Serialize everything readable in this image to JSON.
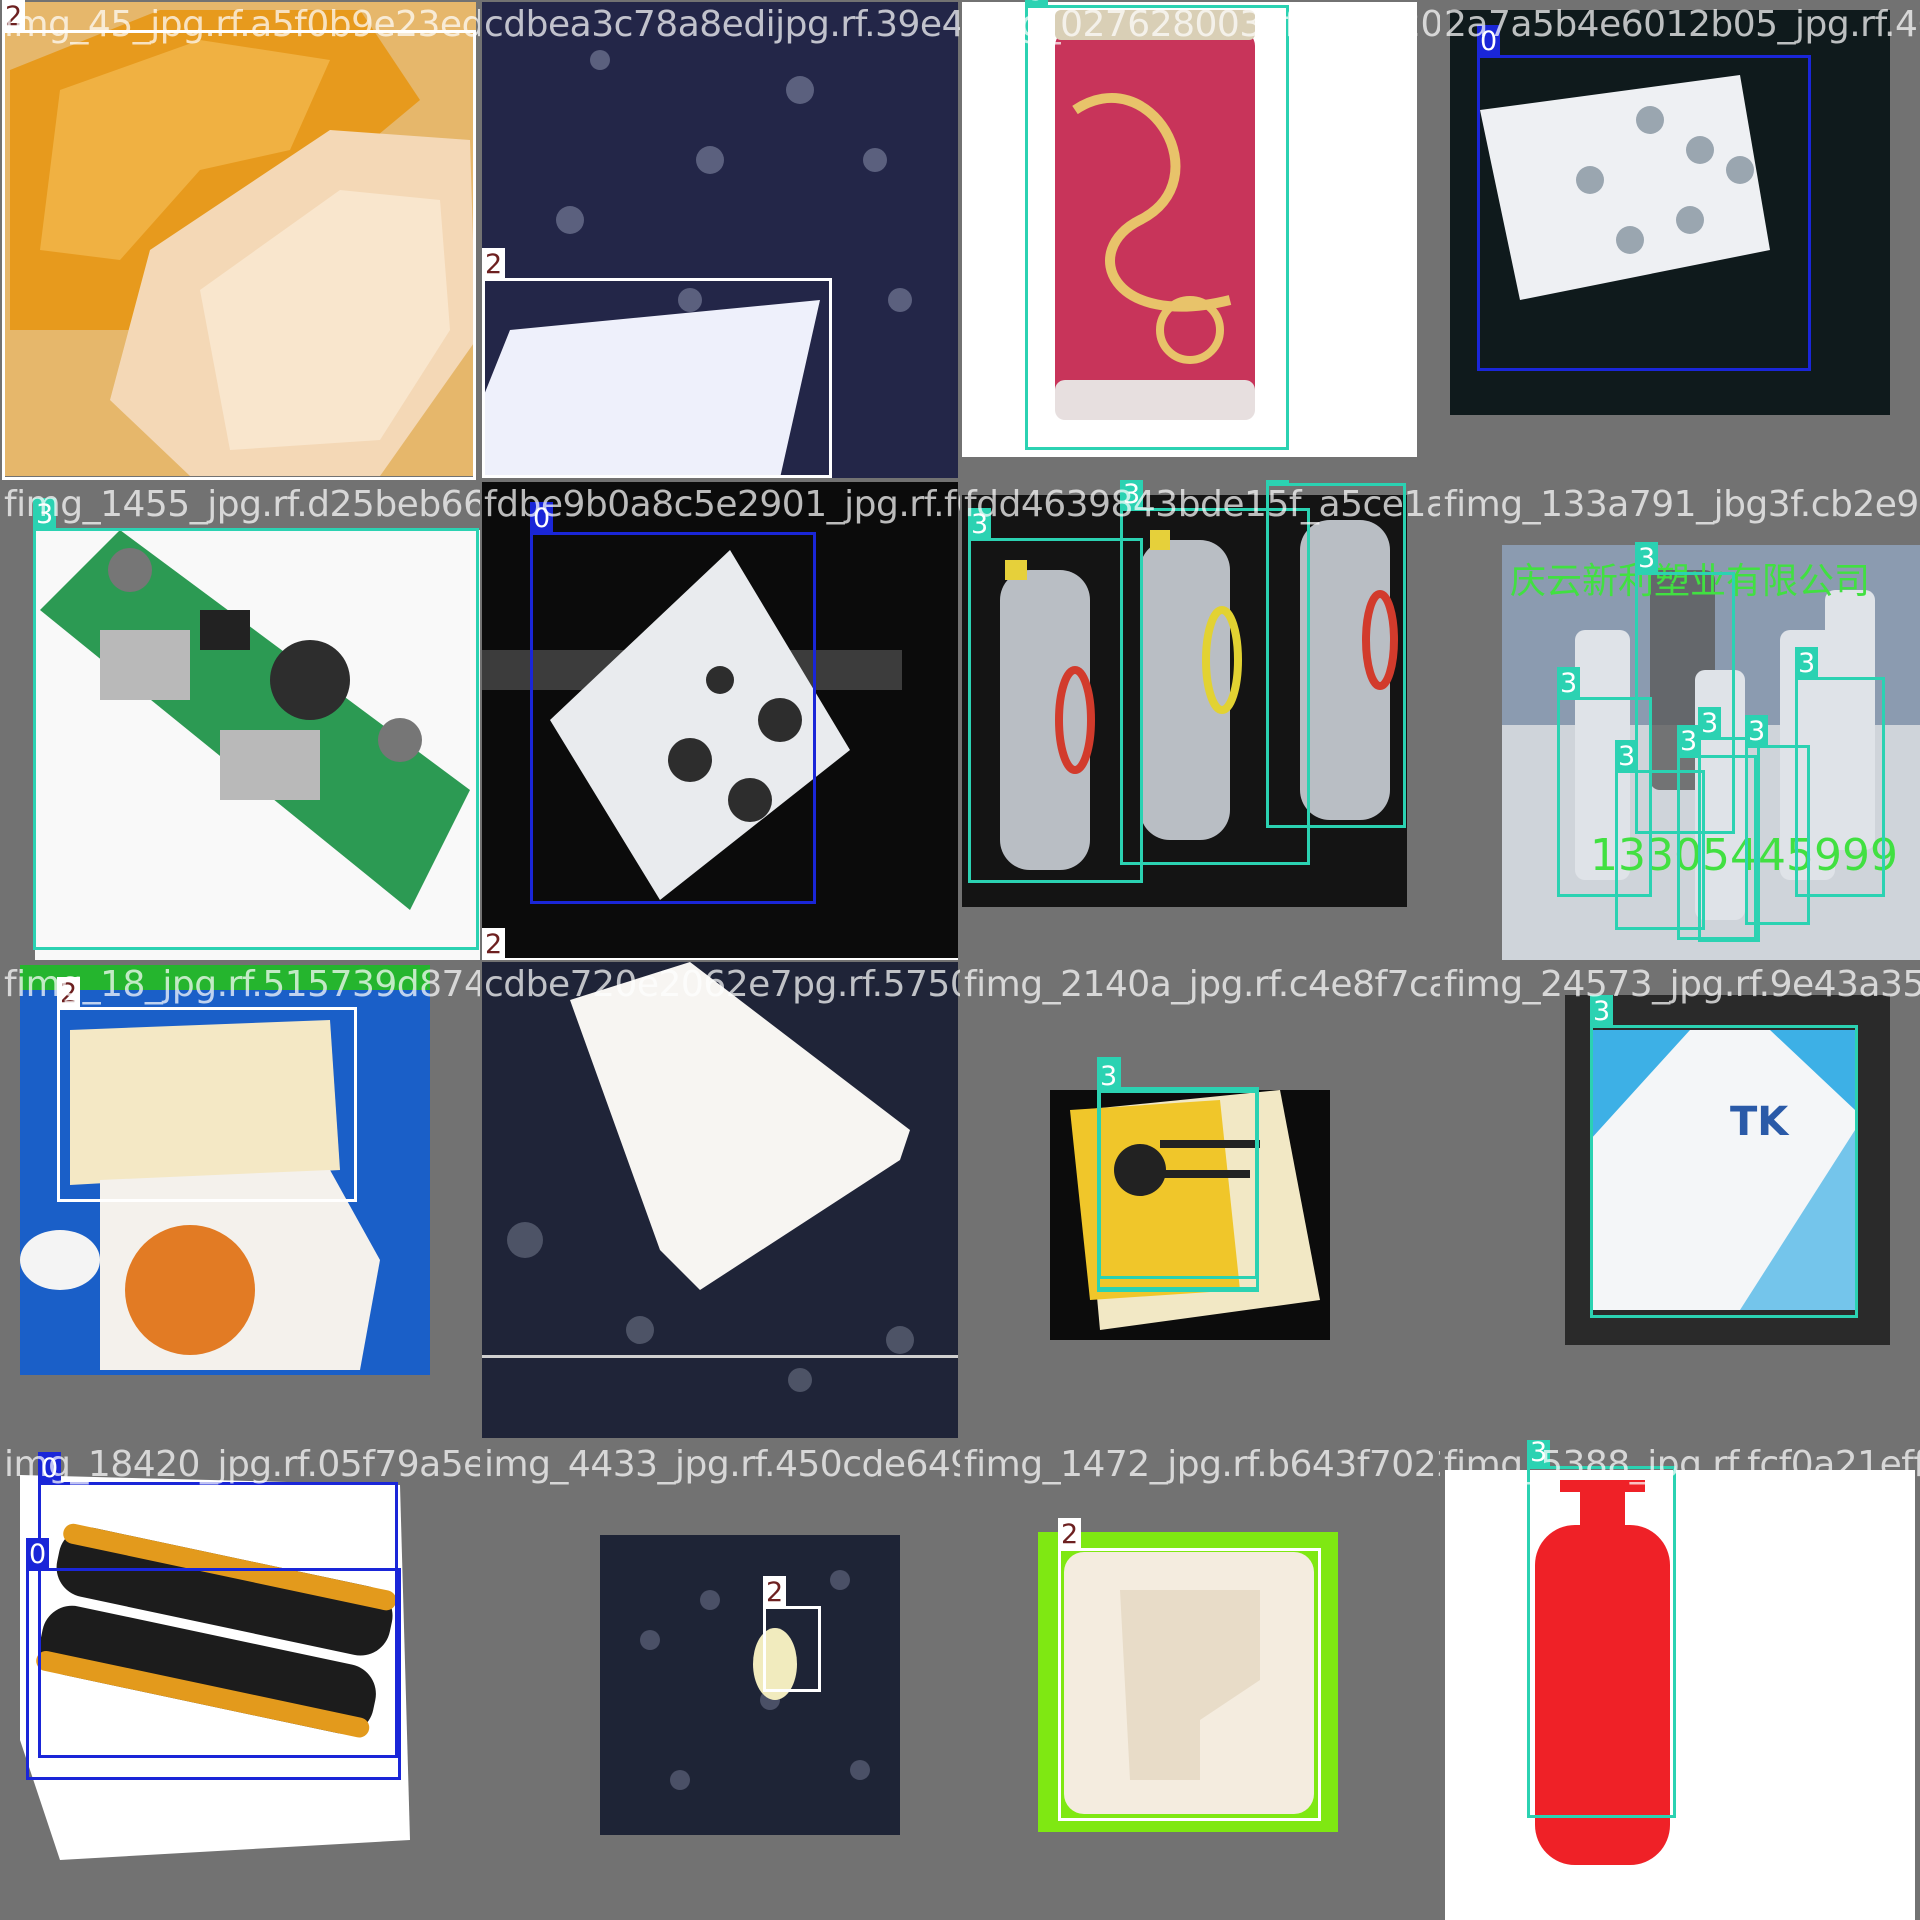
{
  "class_colors": {
    "0": "#1a26d8",
    "2": "#ffffff",
    "3": "#2bd2b2"
  },
  "tiles": [
    {
      "filename": "img_45_jpg.rf.a5f0b9e23eda0b2833a7e235e",
      "labels": [
        "2"
      ]
    },
    {
      "filename": "cdbea3c78a8edijpg.rf.39e452f7f1c3c3a063d08f",
      "labels": [
        "2"
      ]
    },
    {
      "filename": "fimg_0276280030f612df204f32a7a5b4e6012b",
      "labels": [
        "3"
      ]
    },
    {
      "filename": "2a7a5b4e6012b05_jpg.rf.46",
      "labels": [
        "0"
      ]
    },
    {
      "filename": "fimg_1455_jpg.rf.d25beb661d",
      "labels": [
        "3"
      ]
    },
    {
      "filename": "fdbe9b0a8c5e2901_jpg.rf.f0cfd4",
      "labels": [
        "0",
        "2"
      ]
    },
    {
      "filename": "fdd4639843bde15f_a5ce1a3b4cb98139a791_jbg3f",
      "labels": [
        "3",
        "3",
        "3"
      ]
    },
    {
      "filename": "fimg_133a791_jbg3f.cb2e9d601",
      "labels": [
        "3",
        "3",
        "3",
        "3",
        "3",
        "3",
        "3"
      ],
      "overlay_texts": [
        "庆云新利塑业有限公司",
        "13305445999"
      ]
    },
    {
      "filename": "fimg_18_jpg.rf.515739d874eadb",
      "labels": [
        "2"
      ]
    },
    {
      "filename": "cdbe720e2062e7pg.rf.5750a9d31e02403",
      "labels": []
    },
    {
      "filename": "fimg_2140a_jpg.rf.c4e8f7ca0589d",
      "labels": [
        "3",
        "3",
        "3",
        "3"
      ]
    },
    {
      "filename": "fimg_24573_jpg.rf.9e43a35ef",
      "labels": [
        "3"
      ]
    },
    {
      "filename": "img_18420_jpg.rf.05f79a5eeff",
      "labels": [
        "0",
        "0"
      ]
    },
    {
      "filename": "img_4433_jpg.rf.450cde6498bfa",
      "labels": [
        "2"
      ]
    },
    {
      "filename": "fimg_1472_jpg.rf.b643f7022dfd",
      "labels": [
        "2"
      ]
    },
    {
      "filename": "fimg_5388_jpg.rf.fcf0a21effb",
      "labels": [
        "3"
      ]
    }
  ]
}
